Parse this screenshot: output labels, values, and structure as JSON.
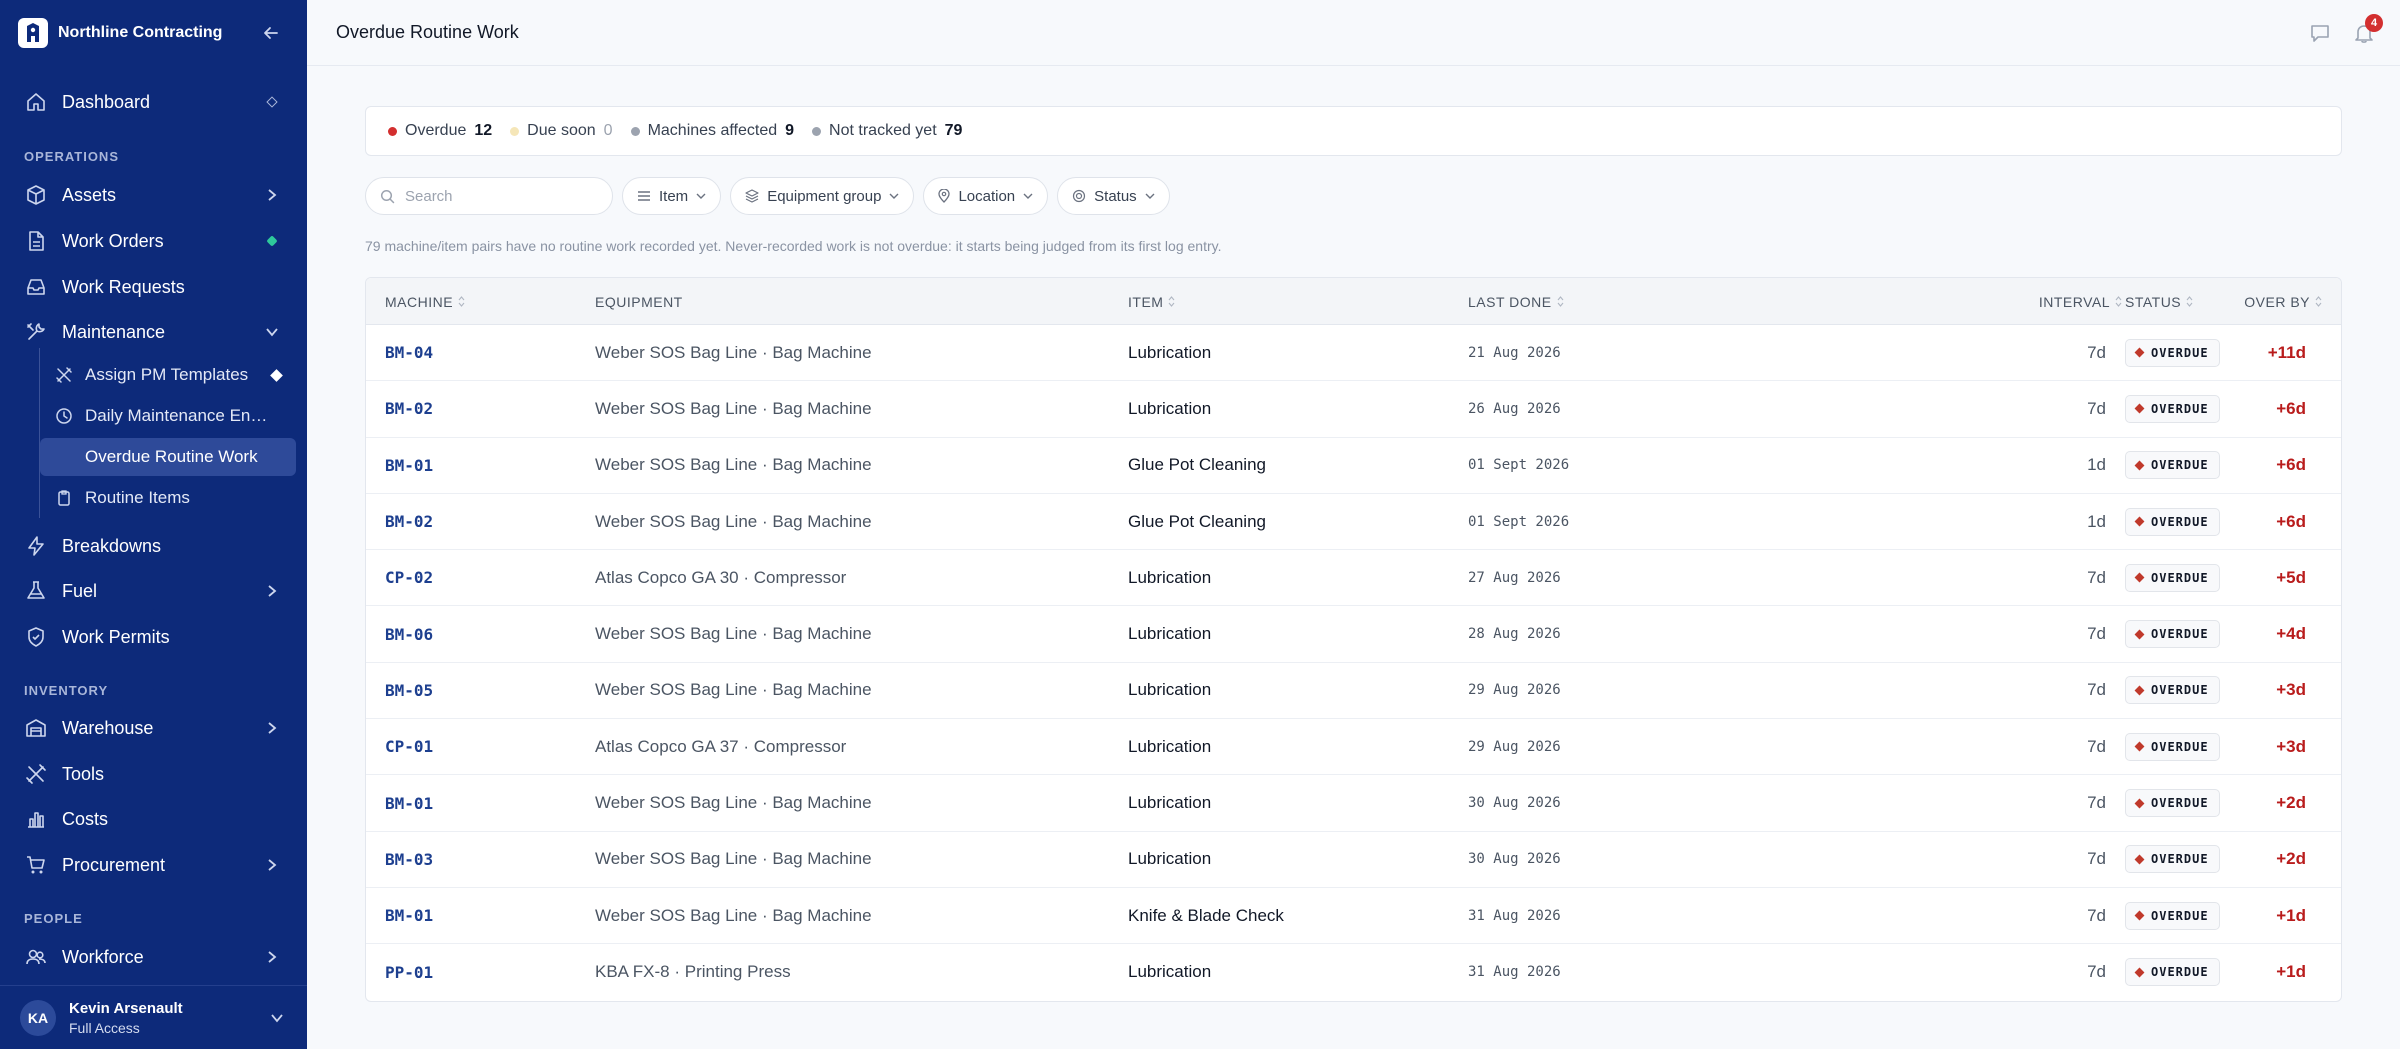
{
  "app": {
    "company": "Northline Contracting"
  },
  "sidebar": {
    "items": [
      {
        "label": "Dashboard"
      },
      {
        "label": "Assets"
      },
      {
        "label": "Work Orders"
      },
      {
        "label": "Work Requests"
      },
      {
        "label": "Maintenance"
      },
      {
        "label": "Breakdowns"
      },
      {
        "label": "Fuel"
      },
      {
        "label": "Work Permits"
      },
      {
        "label": "Warehouse"
      },
      {
        "label": "Tools"
      },
      {
        "label": "Costs"
      },
      {
        "label": "Procurement"
      },
      {
        "label": "Workforce"
      }
    ],
    "maintenance_sub": [
      {
        "label": "Assign PM Templates"
      },
      {
        "label": "Daily Maintenance Entries"
      },
      {
        "label": "Overdue Routine Work"
      },
      {
        "label": "Routine Items"
      }
    ],
    "sections": {
      "operations": "OPERATIONS",
      "inventory": "INVENTORY",
      "people": "PEOPLE"
    },
    "user": {
      "initials": "KA",
      "name": "Kevin Arsenault",
      "role": "Full Access"
    }
  },
  "header": {
    "title": "Overdue Routine Work",
    "notification_count": "4"
  },
  "summary": {
    "overdue_label": "Overdue",
    "overdue_value": "12",
    "due_soon_label": "Due soon",
    "due_soon_value": "0",
    "machines_label": "Machines affected",
    "machines_value": "9",
    "untracked_label": "Not tracked yet",
    "untracked_value": "79",
    "colors": {
      "overdue": "#d32f2f",
      "due_soon": "#f5e6b8",
      "machines": "#9ca3af",
      "untracked": "#9ca3af"
    }
  },
  "filters": {
    "search_placeholder": "Search",
    "item": "Item",
    "equipment_group": "Equipment group",
    "location": "Location",
    "status": "Status"
  },
  "note": "79 machine/item pairs have no routine work recorded yet. Never-recorded work is not overdue: it starts being judged from its first log entry.",
  "table": {
    "headers": {
      "machine": "MACHINE",
      "equipment": "EQUIPMENT",
      "item": "ITEM",
      "last_done": "LAST DONE",
      "interval": "INTERVAL",
      "over_by": "OVER BY",
      "status": "STATUS"
    },
    "rows": [
      {
        "machine": "BM-04",
        "equipment": "Weber SOS Bag Line · Bag Machine",
        "item": "Lubrication",
        "last_done": "21 Aug 2026",
        "interval": "7d",
        "over_by": "+11d",
        "status": "OVERDUE"
      },
      {
        "machine": "BM-02",
        "equipment": "Weber SOS Bag Line · Bag Machine",
        "item": "Lubrication",
        "last_done": "26 Aug 2026",
        "interval": "7d",
        "over_by": "+6d",
        "status": "OVERDUE"
      },
      {
        "machine": "BM-01",
        "equipment": "Weber SOS Bag Line · Bag Machine",
        "item": "Glue Pot Cleaning",
        "last_done": "01 Sept 2026",
        "interval": "1d",
        "over_by": "+6d",
        "status": "OVERDUE"
      },
      {
        "machine": "BM-02",
        "equipment": "Weber SOS Bag Line · Bag Machine",
        "item": "Glue Pot Cleaning",
        "last_done": "01 Sept 2026",
        "interval": "1d",
        "over_by": "+6d",
        "status": "OVERDUE"
      },
      {
        "machine": "CP-02",
        "equipment": "Atlas Copco GA 30 · Compressor",
        "item": "Lubrication",
        "last_done": "27 Aug 2026",
        "interval": "7d",
        "over_by": "+5d",
        "status": "OVERDUE"
      },
      {
        "machine": "BM-06",
        "equipment": "Weber SOS Bag Line · Bag Machine",
        "item": "Lubrication",
        "last_done": "28 Aug 2026",
        "interval": "7d",
        "over_by": "+4d",
        "status": "OVERDUE"
      },
      {
        "machine": "BM-05",
        "equipment": "Weber SOS Bag Line · Bag Machine",
        "item": "Lubrication",
        "last_done": "29 Aug 2026",
        "interval": "7d",
        "over_by": "+3d",
        "status": "OVERDUE"
      },
      {
        "machine": "CP-01",
        "equipment": "Atlas Copco GA 37 · Compressor",
        "item": "Lubrication",
        "last_done": "29 Aug 2026",
        "interval": "7d",
        "over_by": "+3d",
        "status": "OVERDUE"
      },
      {
        "machine": "BM-01",
        "equipment": "Weber SOS Bag Line · Bag Machine",
        "item": "Lubrication",
        "last_done": "30 Aug 2026",
        "interval": "7d",
        "over_by": "+2d",
        "status": "OVERDUE"
      },
      {
        "machine": "BM-03",
        "equipment": "Weber SOS Bag Line · Bag Machine",
        "item": "Lubrication",
        "last_done": "30 Aug 2026",
        "interval": "7d",
        "over_by": "+2d",
        "status": "OVERDUE"
      },
      {
        "machine": "BM-01",
        "equipment": "Weber SOS Bag Line · Bag Machine",
        "item": "Knife & Blade Check",
        "last_done": "31 Aug 2026",
        "interval": "7d",
        "over_by": "+1d",
        "status": "OVERDUE"
      },
      {
        "machine": "PP-01",
        "equipment": "KBA FX-8 · Printing Press",
        "item": "Lubrication",
        "last_done": "31 Aug 2026",
        "interval": "7d",
        "over_by": "+1d",
        "status": "OVERDUE"
      }
    ]
  }
}
